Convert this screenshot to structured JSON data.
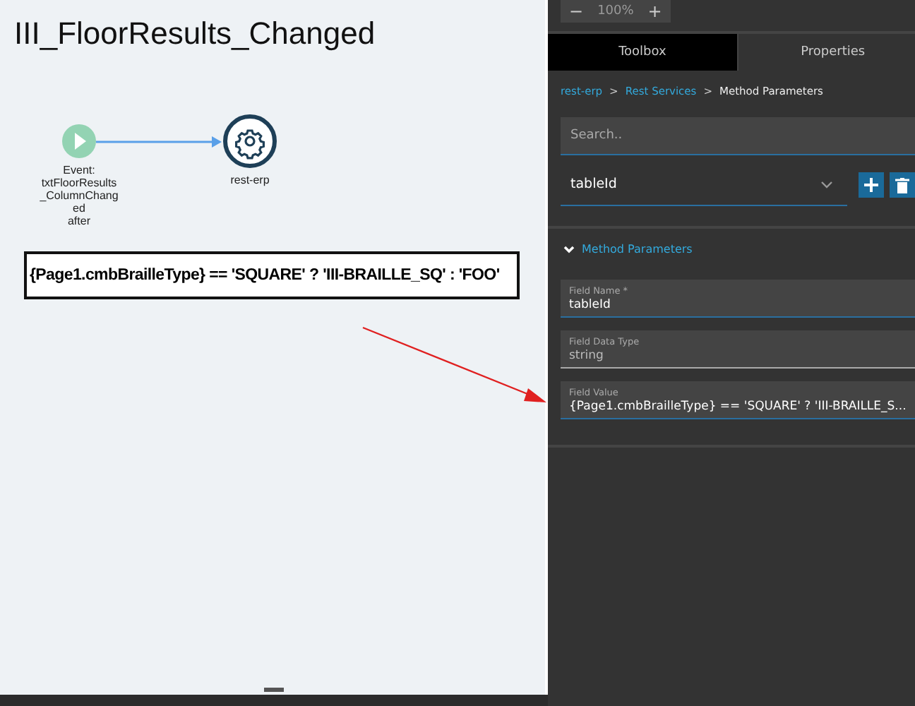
{
  "canvas": {
    "title": "III_FloorResults_Changed",
    "nodes": [
      {
        "kind": "event",
        "label_lines": [
          "Event:",
          "txtFloorResults",
          "_ColumnChang",
          "ed",
          "after"
        ]
      },
      {
        "kind": "service",
        "label_lines": [
          "rest-erp"
        ]
      }
    ],
    "expression": "{Page1.cmbBrailleType} == 'SQUARE' ? 'III-BRAILLE_SQ' : 'FOO'"
  },
  "zoom_control": {
    "value": "100%",
    "minus": "−",
    "plus": "+"
  },
  "tabs": [
    {
      "label": "Toolbox",
      "selected": false
    },
    {
      "label": "Properties",
      "selected": true
    }
  ],
  "breadcrumb": [
    {
      "label": "rest-erp",
      "link": true
    },
    {
      "label": "Rest Services",
      "link": true
    },
    {
      "label": "Method Parameters",
      "link": false
    }
  ],
  "breadcrumb_separator": ">",
  "search": {
    "placeholder": "Search.."
  },
  "method_select": {
    "value": "tableId"
  },
  "section": {
    "title": "Method Parameters",
    "expanded": true
  },
  "fields": [
    {
      "label": "Field Name *",
      "value": "tableId",
      "disabled": false
    },
    {
      "label": "Field Data Type",
      "value": "string",
      "disabled": true
    },
    {
      "label": "Field Value",
      "value": "{Page1.cmbBrailleType} == 'SQUARE' ? 'III-BRAILLE_S...",
      "disabled": false
    }
  ]
}
